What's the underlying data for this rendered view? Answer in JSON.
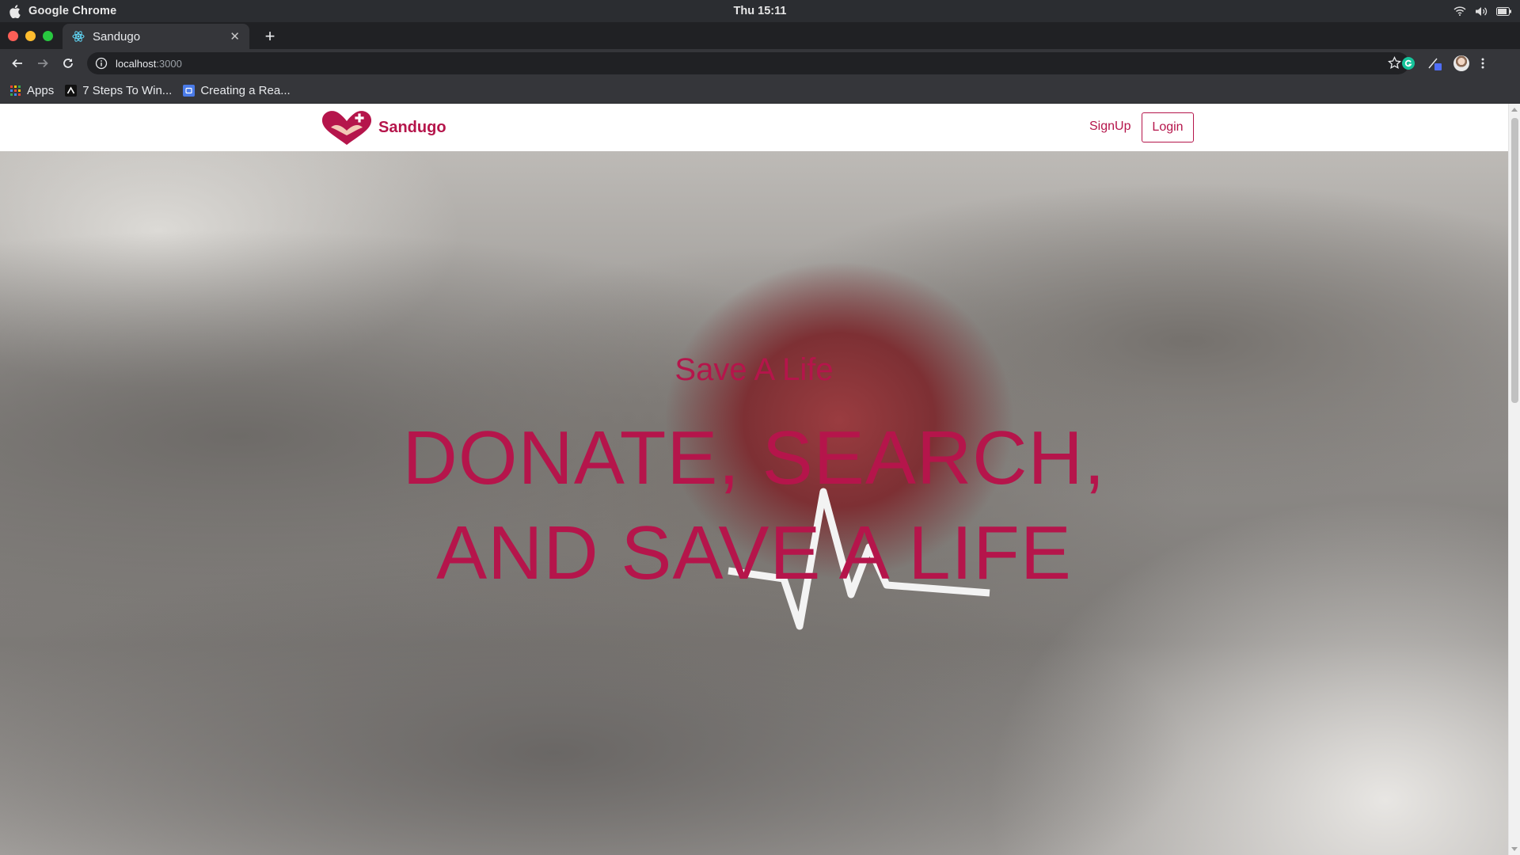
{
  "menubar": {
    "app_name": "Google Chrome",
    "clock": "Thu 15:11"
  },
  "browser": {
    "tab_title": "Sandugo",
    "url_host": "localhost",
    "url_port": ":3000",
    "bookmarks": [
      {
        "label": "Apps",
        "icon": "apps-grid-icon"
      },
      {
        "label": "7 Steps To Win...",
        "icon": "bookmark-logo-icon"
      },
      {
        "label": "Creating a Rea...",
        "icon": "bookmark-page-icon"
      }
    ]
  },
  "page": {
    "brand_name": "Sandugo",
    "nav": {
      "signup_label": "SignUp",
      "login_label": "Login"
    },
    "hero": {
      "subtitle": "Save A Life",
      "headline_line1": "DONATE, SEARCH,",
      "headline_line2": "AND SAVE A LIFE"
    }
  },
  "colors": {
    "brand": "#b5154b",
    "chrome_dark": "#202124",
    "chrome_toolbar": "#35363a"
  }
}
